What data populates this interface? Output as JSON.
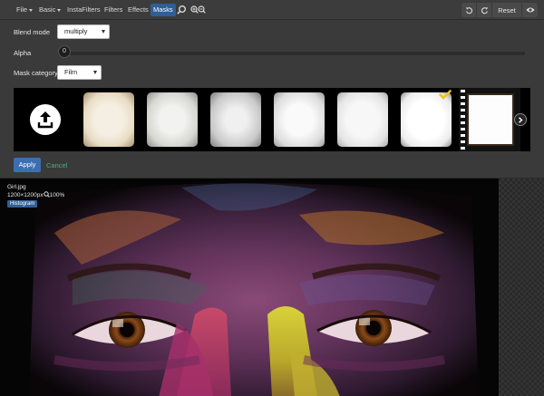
{
  "toolbar": {
    "menus": [
      {
        "label": "File"
      },
      {
        "label": "Basic"
      },
      {
        "label": "InstaFilters"
      },
      {
        "label": "Filters"
      },
      {
        "label": "Effects"
      },
      {
        "label": "Masks"
      }
    ],
    "active_menu": "Masks",
    "search_icon": "search-icon",
    "zoom_icons": [
      "zoom-in-icon",
      "zoom-out-icon"
    ],
    "undo_icon": "undo-icon",
    "redo_icon": "redo-icon",
    "reset_label": "Reset",
    "preview_icon": "eye-icon"
  },
  "masks_panel": {
    "blend_mode_label": "Blend mode",
    "blend_mode_value": "multiply",
    "alpha_label": "Alpha",
    "alpha_value": "0",
    "mask_category_label": "Mask category",
    "mask_category_value": "Film",
    "upload_icon": "upload-icon",
    "selected_thumb_index": 6,
    "apply_label": "Apply",
    "cancel_label": "Cancel"
  },
  "image_info": {
    "filename": "Girl.jpg",
    "dimensions": "1200×1200px",
    "zoom": "100%",
    "histogram_label": "Histogram"
  },
  "colors": {
    "accent": "#2f5f96",
    "apply_button": "#3b6fb0",
    "cancel_text": "#4caf7d",
    "panel_bg": "#3a3a3a"
  }
}
